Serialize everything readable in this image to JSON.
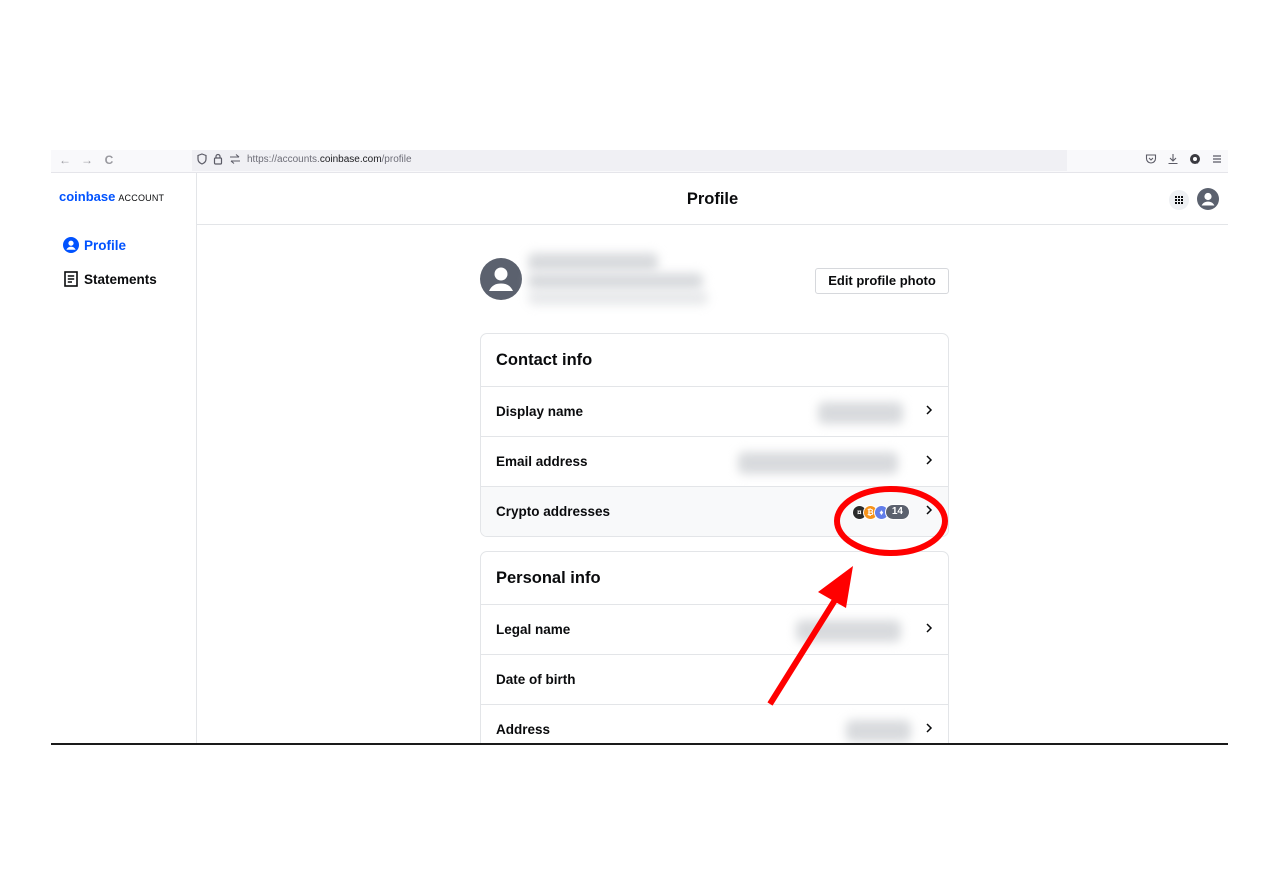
{
  "browser": {
    "back_glyph": "←",
    "forward_glyph": "→",
    "reload_glyph": "C",
    "url_prefix": "https://accounts.",
    "url_domain": "coinbase.com",
    "url_path": "/profile",
    "icons": [
      "back-icon",
      "forward-icon",
      "reload-icon",
      "shield-icon",
      "lock-icon",
      "permissions-icon",
      "star-icon",
      "pocket-icon",
      "download-icon",
      "extension-icon",
      "menu-icon"
    ]
  },
  "sidebar": {
    "logo": "coinbase",
    "logo_suffix": "ACCOUNT",
    "items": [
      {
        "label": "Profile",
        "icon": "user-circle-icon",
        "active": true
      },
      {
        "label": "Statements",
        "icon": "document-icon",
        "active": false
      }
    ]
  },
  "header": {
    "title": "Profile",
    "icons": [
      "apps-grid-icon",
      "user-avatar-icon"
    ]
  },
  "profile": {
    "edit_photo_label": "Edit profile photo"
  },
  "contact_info": {
    "title": "Contact info",
    "rows": [
      {
        "label": "Display name"
      },
      {
        "label": "Email address"
      },
      {
        "label": "Crypto addresses",
        "count": "14"
      }
    ]
  },
  "personal_info": {
    "title": "Personal info",
    "rows": [
      {
        "label": "Legal name"
      },
      {
        "label": "Date of birth"
      },
      {
        "label": "Address"
      }
    ]
  },
  "colors": {
    "brand": "#0052ff",
    "annotation": "#ff0000",
    "coin_colors": [
      "#2b2b2b",
      "#f7931a",
      "#627eea"
    ]
  }
}
